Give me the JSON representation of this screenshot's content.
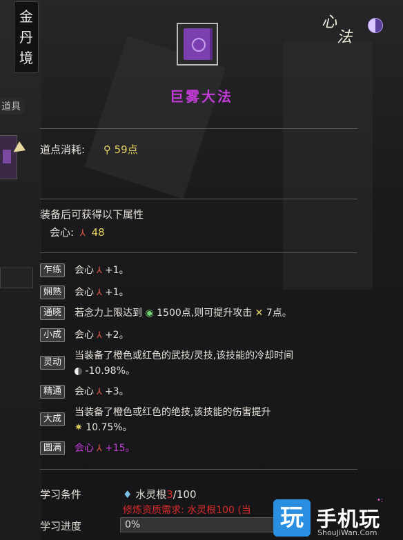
{
  "realm": {
    "chars": [
      "金",
      "丹",
      "境"
    ]
  },
  "side": {
    "tab_label": "道具"
  },
  "header": {
    "xinfa_chars": [
      "心",
      "法"
    ],
    "icons": {
      "yinyang": "yinyang-icon",
      "book": "purple-book-icon"
    }
  },
  "skill": {
    "name": "巨雾大法"
  },
  "cost": {
    "label": "道点消耗:",
    "value": "59点"
  },
  "attrs": {
    "heading": "装备后可获得以下属性",
    "label": "会心:",
    "value": "48"
  },
  "tiers": [
    {
      "badge": "乍练",
      "text": "会心",
      "value": "+1。"
    },
    {
      "badge": "娴熟",
      "text": "会心",
      "value": "+1。"
    },
    {
      "badge": "通晓",
      "text_a": "若念力上限达到",
      "val_a": "1500点",
      "text_b": ",则可提升攻击",
      "val_b": "7点。"
    },
    {
      "badge": "小成",
      "text": "会心",
      "value": "+2。"
    },
    {
      "badge": "灵动",
      "line1": "当装备了橙色或红色的武技/灵技,该技能的冷却时间",
      "line2": "-10.98%。"
    },
    {
      "badge": "精通",
      "text": "会心",
      "value": "+3。"
    },
    {
      "badge": "大成",
      "line1": "当装备了橙色或红色的绝技,该技能的伤害提升",
      "line2": "10.75%。"
    },
    {
      "badge": "圆满",
      "text": "会心",
      "value": "+15。"
    }
  ],
  "study": {
    "cond_label": "学习条件",
    "root_name": "水灵根",
    "root_current": "3",
    "root_total": "/100",
    "requirement": "修炼资质需求: 水灵根100 (当",
    "progress_label": "学习进度",
    "progress_value": "0%"
  },
  "watermark": {
    "glyph": "玩",
    "text": "手机玩",
    "sub": "ShouJiWan.Com"
  },
  "colors": {
    "purple": "#c33bd9",
    "yellow": "#e6d260",
    "red": "#d92a2a"
  }
}
